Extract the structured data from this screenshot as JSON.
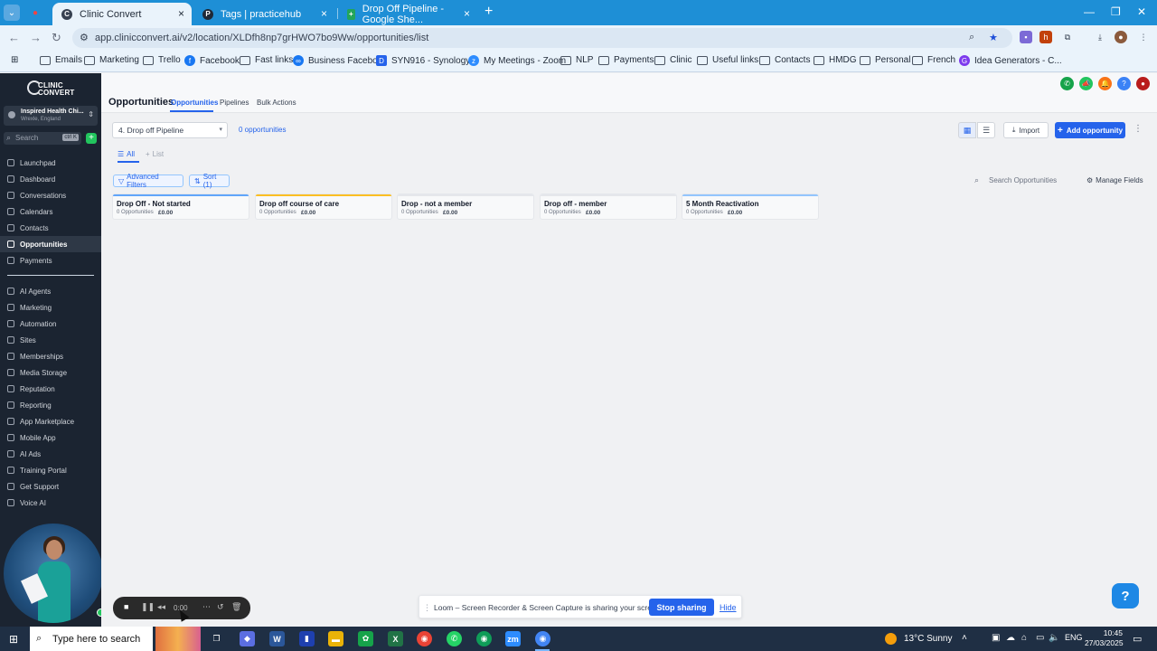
{
  "browser": {
    "tabs": [
      {
        "title": "Clinic Convert",
        "active": true
      },
      {
        "title": "Tags | practicehub",
        "active": false
      },
      {
        "title": "Drop Off Pipeline - Google She...",
        "active": false
      }
    ],
    "url": "app.clinicconvert.ai/v2/location/XLDfh8np7grHWO7bo9Ww/opportunities/list",
    "bookmarks": [
      "Emails",
      "Marketing",
      "Trello",
      "Facebook",
      "Fast links",
      "Business Facebook",
      "SYN916 - Synology...",
      "My Meetings - Zoom",
      "NLP",
      "Payments",
      "Clinic",
      "Useful links",
      "Contacts",
      "HMDG",
      "Personal",
      "French",
      "Idea Generators - C..."
    ]
  },
  "sidebar": {
    "logo_line1": "CLINIC",
    "logo_line2": "CONVERT",
    "account_name": "Inspired Health Chi...",
    "account_location": "Wrexle, England",
    "search_placeholder": "Search",
    "search_shortcut": "ctrl K",
    "nav_primary": [
      "Launchpad",
      "Dashboard",
      "Conversations",
      "Calendars",
      "Contacts",
      "Opportunities",
      "Payments"
    ],
    "nav_secondary": [
      "AI Agents",
      "Marketing",
      "Automation",
      "Sites",
      "Memberships",
      "Media Storage",
      "Reputation",
      "Reporting",
      "App Marketplace",
      "Mobile App",
      "AI Ads",
      "Training Portal",
      "Get Support",
      "Voice AI"
    ],
    "active_item": "Opportunities"
  },
  "header": {
    "page_title": "Opportunities",
    "tabs": [
      "Opportunities",
      "Pipelines",
      "Bulk Actions"
    ]
  },
  "toolbar": {
    "pipeline_selected": "4. Drop off Pipeline",
    "opportunity_count": "0 opportunities",
    "import_label": "Import",
    "add_label": "Add opportunity",
    "view_tabs": [
      "All",
      "List"
    ],
    "advanced_filters_label": "Advanced Filters",
    "sort_label": "Sort (1)",
    "search_placeholder": "Search Opportunities",
    "manage_fields_label": "Manage Fields"
  },
  "stages": [
    {
      "name": "Drop Off - Not started",
      "count": "0 Opportunities",
      "value": "£0.00",
      "color": "#60a5fa"
    },
    {
      "name": "Drop off course of care",
      "count": "0 Opportunities",
      "value": "£0.00",
      "color": "#fbbf24"
    },
    {
      "name": "Drop - not a member",
      "count": "0 Opportunities",
      "value": "£0.00",
      "color": "#e5e7eb"
    },
    {
      "name": "Drop off - member",
      "count": "0 Opportunities",
      "value": "£0.00",
      "color": "#e5e7eb"
    },
    {
      "name": "5 Month Reactivation",
      "count": "0 Opportunities",
      "value": "£0.00",
      "color": "#93c5fd"
    }
  ],
  "loom": {
    "time": "0:00",
    "message": "Loom – Screen Recorder & Screen Capture is sharing your screen.",
    "stop_label": "Stop sharing",
    "hide_label": "Hide"
  },
  "taskbar": {
    "search_placeholder": "Type here to search",
    "weather": "13°C  Sunny",
    "language": "ENG",
    "time": "10:45",
    "date": "27/03/2025"
  },
  "colors": {
    "accent": "#2563eb",
    "sidebar_bg": "#1b2431",
    "tabstrip": "#1e8fd6"
  }
}
